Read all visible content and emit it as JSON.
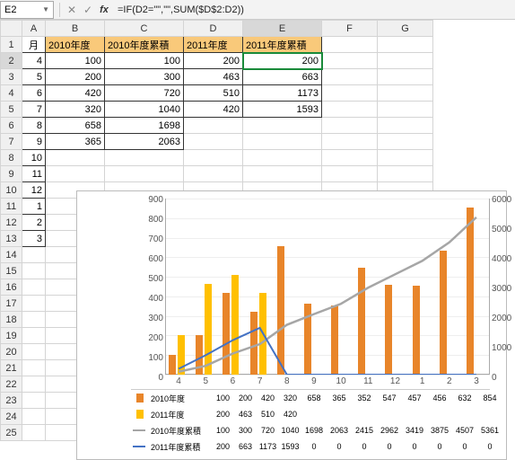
{
  "name_box": "E2",
  "formula": "=IF(D2=\"\",\"\",SUM($D$2:D2))",
  "grid": {
    "col_headers": [
      "A",
      "B",
      "C",
      "D",
      "E",
      "F",
      "G"
    ],
    "row_headers": [
      "1",
      "2",
      "3",
      "4",
      "5",
      "6",
      "7",
      "8",
      "9",
      "10",
      "11",
      "12",
      "13",
      "14",
      "15",
      "16",
      "17",
      "18",
      "19",
      "20",
      "21",
      "22",
      "23",
      "24",
      "25"
    ],
    "headers": {
      "A": "月",
      "B": "2010年度",
      "C": "2010年度累積",
      "D": "2011年度",
      "E": "2011年度累積"
    },
    "rows": [
      {
        "A": "4",
        "B": "100",
        "C": "100",
        "D": "200",
        "E": "200"
      },
      {
        "A": "5",
        "B": "200",
        "C": "300",
        "D": "463",
        "E": "663"
      },
      {
        "A": "6",
        "B": "420",
        "C": "720",
        "D": "510",
        "E": "1173"
      },
      {
        "A": "7",
        "B": "320",
        "C": "1040",
        "D": "420",
        "E": "1593"
      },
      {
        "A": "8",
        "B": "658",
        "C": "1698",
        "D": "",
        "E": ""
      },
      {
        "A": "9",
        "B": "365",
        "C": "2063",
        "D": "",
        "E": ""
      },
      {
        "A": "10",
        "B": "",
        "C": "",
        "D": "",
        "E": ""
      },
      {
        "A": "11",
        "B": "",
        "C": "",
        "D": "",
        "E": ""
      },
      {
        "A": "12",
        "B": "",
        "C": "",
        "D": "",
        "E": ""
      },
      {
        "A": "1",
        "B": "",
        "C": "",
        "D": "",
        "E": ""
      },
      {
        "A": "2",
        "B": "",
        "C": "",
        "D": "",
        "E": ""
      },
      {
        "A": "3",
        "B": "",
        "C": "",
        "D": "",
        "E": ""
      }
    ]
  },
  "chart_data": {
    "type": "bar",
    "categories": [
      "4",
      "5",
      "6",
      "7",
      "8",
      "9",
      "10",
      "11",
      "12",
      "1",
      "2",
      "3"
    ],
    "series": [
      {
        "name": "2010年度",
        "type": "bar",
        "axis": "y1",
        "color": "#e8852a",
        "values": [
          100,
          200,
          420,
          320,
          658,
          365,
          352,
          547,
          457,
          456,
          632,
          854
        ]
      },
      {
        "name": "2011年度",
        "type": "bar",
        "axis": "y1",
        "color": "#ffc000",
        "values": [
          200,
          463,
          510,
          420,
          null,
          null,
          null,
          null,
          null,
          null,
          null,
          null
        ]
      },
      {
        "name": "2010年度累積",
        "type": "line",
        "axis": "y2",
        "color": "#a6a6a6",
        "values": [
          100,
          300,
          720,
          1040,
          1698,
          2063,
          2415,
          2962,
          3419,
          3875,
          4507,
          5361
        ]
      },
      {
        "name": "2011年度累積",
        "type": "line",
        "axis": "y2",
        "color": "#4472c4",
        "values": [
          200,
          663,
          1173,
          1593,
          0,
          0,
          0,
          0,
          0,
          0,
          0,
          0
        ]
      }
    ],
    "y1": {
      "min": 0,
      "max": 900,
      "step": 100
    },
    "y2": {
      "min": 0,
      "max": 6000,
      "step": 1000
    },
    "xlabel": "",
    "ylabel": "",
    "title": ""
  },
  "dt": {
    "rows": [
      {
        "label": "2010年度",
        "swatch": "bar-o",
        "vals": [
          "100",
          "200",
          "420",
          "320",
          "658",
          "365",
          "352",
          "547",
          "457",
          "456",
          "632",
          "854"
        ]
      },
      {
        "label": "2011年度",
        "swatch": "bar-y",
        "vals": [
          "200",
          "463",
          "510",
          "420",
          "",
          "",
          "",
          "",
          "",
          "",
          "",
          ""
        ]
      },
      {
        "label": "2010年度累積",
        "swatch": "line-g",
        "vals": [
          "100",
          "300",
          "720",
          "1040",
          "1698",
          "2063",
          "2415",
          "2962",
          "3419",
          "3875",
          "4507",
          "5361"
        ]
      },
      {
        "label": "2011年度累積",
        "swatch": "line-b",
        "vals": [
          "200",
          "663",
          "1173",
          "1593",
          "0",
          "0",
          "0",
          "0",
          "0",
          "0",
          "0",
          "0"
        ]
      }
    ]
  }
}
